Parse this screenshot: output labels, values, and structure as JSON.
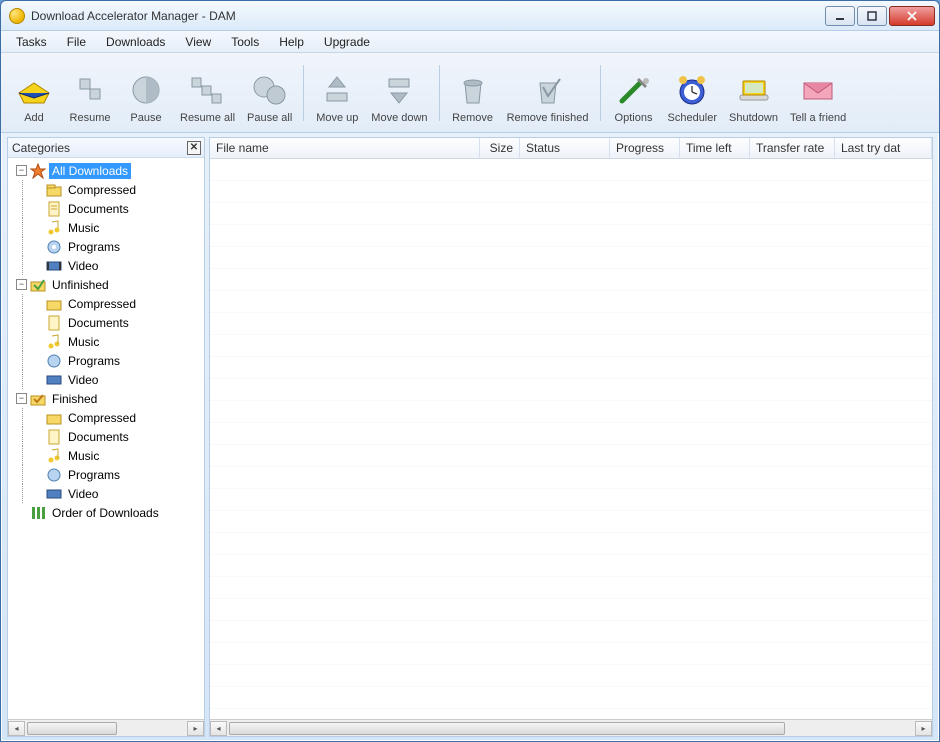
{
  "window": {
    "title": "Download Accelerator Manager - DAM"
  },
  "menus": [
    "Tasks",
    "File",
    "Downloads",
    "View",
    "Tools",
    "Help",
    "Upgrade"
  ],
  "toolbar": {
    "groups": [
      [
        "Add",
        "Resume",
        "Pause",
        "Resume all",
        "Pause all"
      ],
      [
        "Move up",
        "Move down"
      ],
      [
        "Remove",
        "Remove finished"
      ],
      [
        "Options",
        "Scheduler",
        "Shutdown",
        "Tell a friend"
      ]
    ],
    "buttons": {
      "add": "Add",
      "resume": "Resume",
      "pause": "Pause",
      "resume_all": "Resume all",
      "pause_all": "Pause all",
      "move_up": "Move up",
      "move_down": "Move down",
      "remove": "Remove",
      "remove_finished": "Remove finished",
      "options": "Options",
      "scheduler": "Scheduler",
      "shutdown": "Shutdown",
      "tell": "Tell a friend"
    }
  },
  "sidebar": {
    "title": "Categories",
    "tree": {
      "all": "All Downloads",
      "unfinished": "Unfinished",
      "finished": "Finished",
      "order": "Order of Downloads",
      "children": [
        "Compressed",
        "Documents",
        "Music",
        "Programs",
        "Video"
      ]
    }
  },
  "grid": {
    "columns": [
      "File name",
      "Size",
      "Status",
      "Progress",
      "Time left",
      "Transfer rate",
      "Last try dat"
    ]
  }
}
